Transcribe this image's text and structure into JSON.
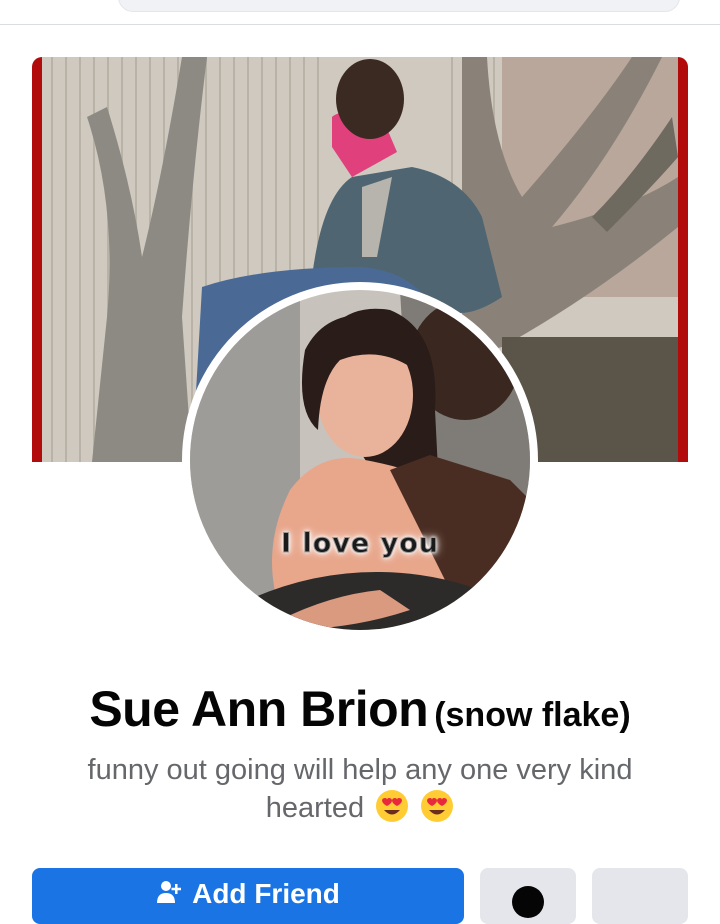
{
  "profile": {
    "name": "Sue Ann Brion",
    "alternate_name": "(snow flake)",
    "bio": "funny out going will help any one very kind hearted",
    "bio_emoji": [
      "heart-eyes-emoji",
      "heart-eyes-emoji"
    ],
    "profile_photo_caption": "I love you"
  },
  "actions": {
    "add_friend_label": "Add Friend"
  },
  "colors": {
    "primary_button": "#1b74e4",
    "secondary_button": "#e4e6eb",
    "bio_text": "#65676b",
    "cover_border": "#b10b0b"
  },
  "icons": {
    "add_friend": "person-plus-icon",
    "message": "messenger-icon",
    "more": "more-icon"
  }
}
